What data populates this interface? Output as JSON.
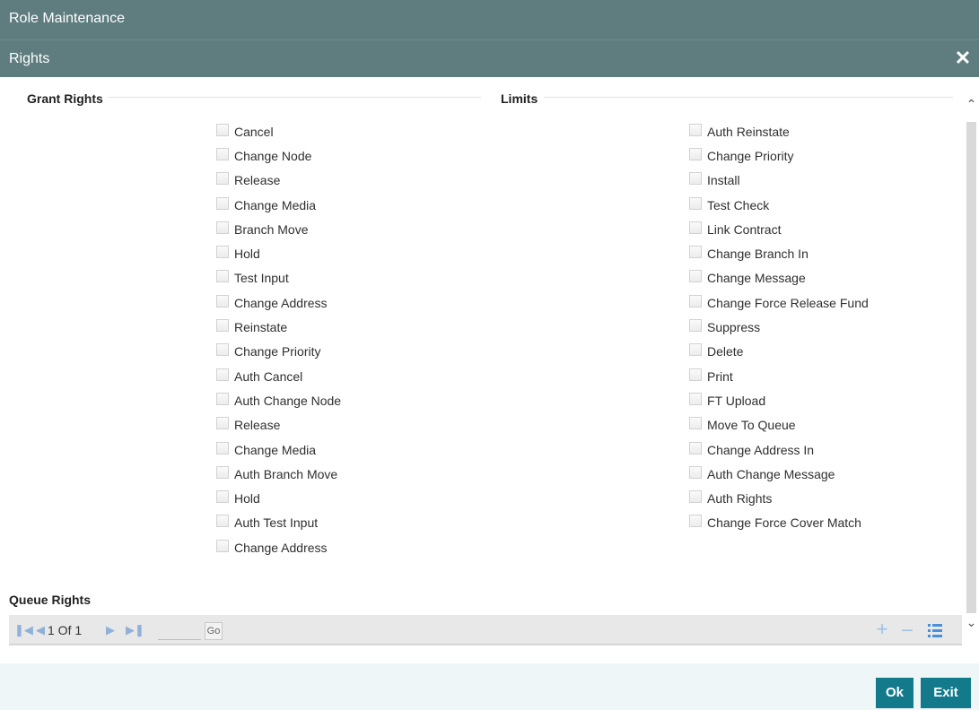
{
  "window": {
    "title": "Role Maintenance"
  },
  "dialog": {
    "title": "Rights",
    "close_icon": "close-icon"
  },
  "sections": {
    "grant_rights": "Grant Rights",
    "limits": "Limits",
    "queue_rights": "Queue Rights"
  },
  "grant_rights": [
    {
      "label": "Cancel"
    },
    {
      "label": "Change Node"
    },
    {
      "label": "Release"
    },
    {
      "label": "Change Media"
    },
    {
      "label": "Branch Move"
    },
    {
      "label": "Hold"
    },
    {
      "label": "Test Input"
    },
    {
      "label": "Change Address"
    },
    {
      "label": "Reinstate"
    },
    {
      "label": "Change Priority"
    },
    {
      "label": "Auth Cancel"
    },
    {
      "label": "Auth Change Node"
    },
    {
      "label": "Release"
    },
    {
      "label": "Change Media"
    },
    {
      "label": "Auth Branch Move"
    },
    {
      "label": "Hold"
    },
    {
      "label": "Auth Test Input"
    },
    {
      "label": "Change Address"
    }
  ],
  "limits": [
    {
      "label": "Auth Reinstate"
    },
    {
      "label": "Change Priority"
    },
    {
      "label": "Install"
    },
    {
      "label": "Test Check"
    },
    {
      "label": "Link Contract"
    },
    {
      "label": "Change Branch In"
    },
    {
      "label": "Change Message"
    },
    {
      "label": "Change Force Release Fund"
    },
    {
      "label": "Suppress"
    },
    {
      "label": "Delete"
    },
    {
      "label": "Print"
    },
    {
      "label": "FT Upload"
    },
    {
      "label": "Move To Queue"
    },
    {
      "label": "Change Address In"
    },
    {
      "label": "Auth Change Message"
    },
    {
      "label": "Auth Rights"
    },
    {
      "label": "Change Force Cover Match"
    }
  ],
  "pager": {
    "page_text": "1 Of 1",
    "go_label": "Go",
    "input_value": ""
  },
  "buttons": {
    "ok": "Ok",
    "exit": "Exit"
  },
  "colors": {
    "header": "#5f7d7f",
    "button": "#137a8c",
    "footer": "#eef6f8",
    "pager_icon": "#8fb0d8"
  }
}
